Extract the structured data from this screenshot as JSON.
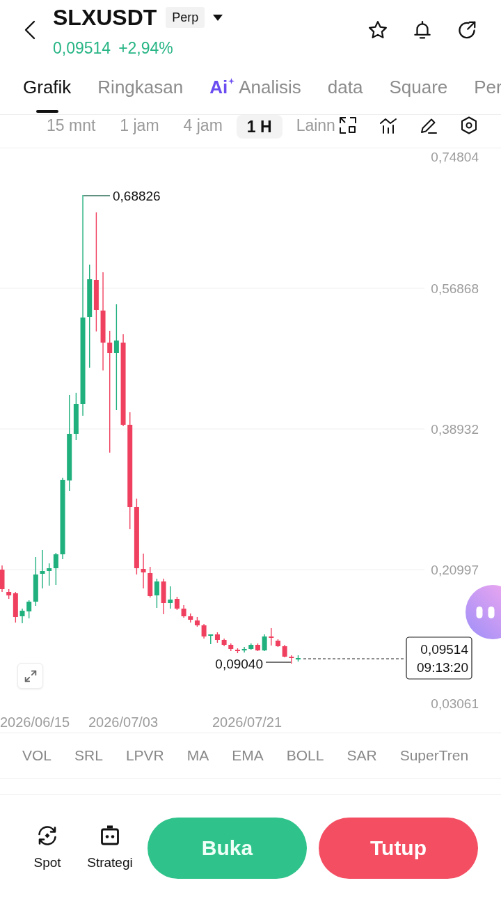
{
  "header": {
    "symbol": "SLXUSDT",
    "contract_type": "Perp",
    "last_price": "0,09514",
    "change_percent": "+2,94%"
  },
  "tabs": [
    {
      "label": "Grafik",
      "selected": true
    },
    {
      "label": "Ringkasan",
      "selected": false
    },
    {
      "label": "Analisis",
      "badge": "Ai",
      "selected": false
    },
    {
      "label": "data",
      "selected": false
    },
    {
      "label": "Square",
      "selected": false
    },
    {
      "label": "Per",
      "selected": false
    }
  ],
  "timeframes": [
    {
      "label": "15 mnt",
      "selected": false
    },
    {
      "label": "1 jam",
      "selected": false
    },
    {
      "label": "4 jam",
      "selected": false
    },
    {
      "label": "1 H",
      "selected": true
    },
    {
      "label": "Lainn",
      "selected": false
    }
  ],
  "chart": {
    "price_axis": [
      "0,74804",
      "0,56868",
      "0,38932",
      "0,20997",
      "0,03061"
    ],
    "date_axis": [
      "2026/06/15",
      "2026/07/03",
      "2026/07/21"
    ],
    "high_marker": "0,68826",
    "low_marker": "0,09040",
    "last_price": "0,09514",
    "countdown": "09:13:20"
  },
  "indicators": [
    "VOL",
    "SRL",
    "LPVR",
    "MA",
    "EMA",
    "BOLL",
    "SAR",
    "SuperTren"
  ],
  "bottom_bar": {
    "shortcuts": [
      {
        "label": "Spot",
        "kind": "spot"
      },
      {
        "label": "Strategi",
        "kind": "bot"
      }
    ],
    "open_button": "Buka",
    "close_button": "Tutup"
  }
}
